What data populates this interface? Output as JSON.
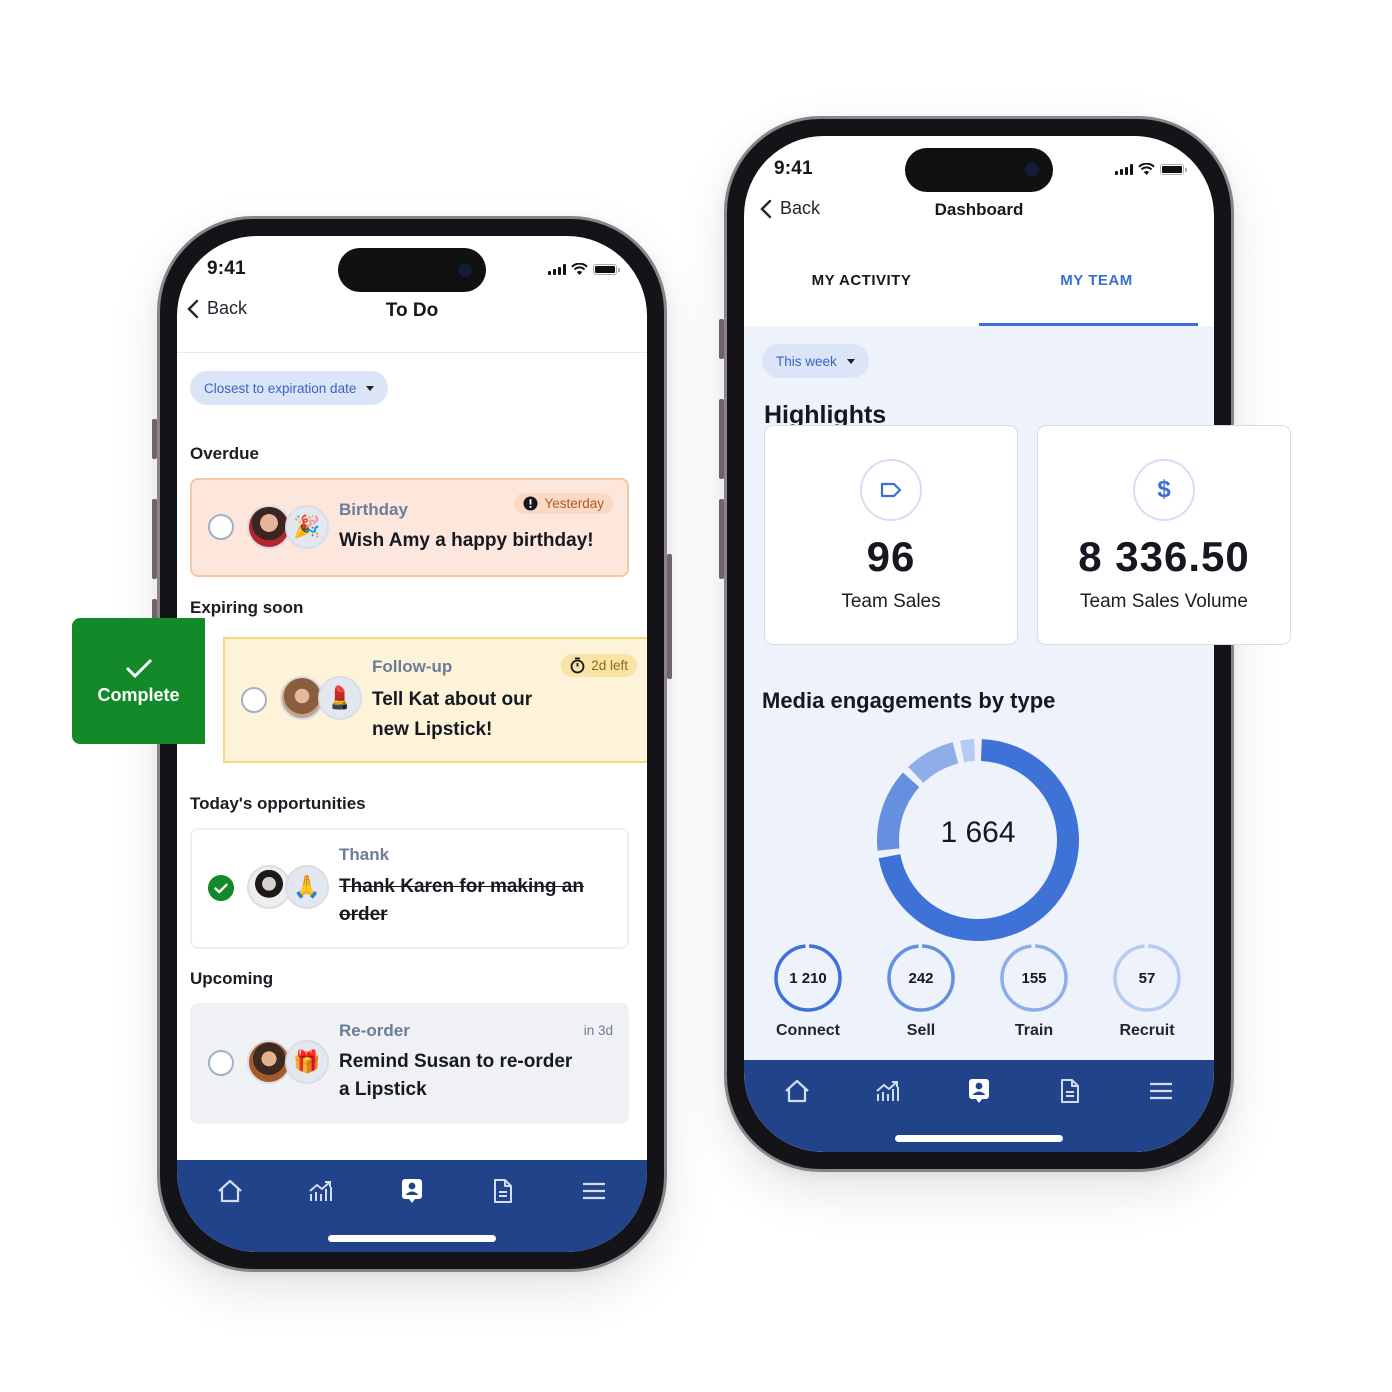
{
  "status_bar": {
    "time": "9:41"
  },
  "todo": {
    "back_label": "Back",
    "title": "To Do",
    "sort_filter": "Closest to expiration date",
    "sections": [
      {
        "heading": "Overdue",
        "task": {
          "type": "Birthday",
          "message": "Wish Amy a happy birthday!",
          "due": "Yesterday",
          "due_icon": "alert-icon",
          "emoji": "🎉",
          "completed": false
        }
      },
      {
        "heading": "Expiring soon",
        "task": {
          "type": "Follow-up",
          "message_line1": "Tell Kat about our",
          "message_line2": "new Lipstick!",
          "due": "2d left",
          "due_icon": "stopwatch-icon",
          "emoji": "💄",
          "completed": false
        }
      },
      {
        "heading": "Today's opportunities",
        "task": {
          "type": "Thank",
          "message_line1": "Thank Karen for making an",
          "message_line2": "order",
          "emoji": "🙏",
          "completed": true
        }
      },
      {
        "heading": "Upcoming",
        "task": {
          "type": "Re-order",
          "message_line1": "Remind Susan to re-order",
          "message_line2": "a Lipstick",
          "due": "in 3d",
          "emoji": "🎁",
          "completed": false
        }
      }
    ],
    "swipe_action": "Complete"
  },
  "dashboard": {
    "back_label": "Back",
    "title": "Dashboard",
    "tabs": [
      {
        "label": "MY ACTIVITY",
        "active": false
      },
      {
        "label": "MY TEAM",
        "active": true
      }
    ],
    "period_filter": "This week",
    "highlights_heading": "Highlights",
    "highlights": [
      {
        "icon": "tag-icon",
        "value": "96",
        "label": "Team Sales"
      },
      {
        "icon": "dollar-icon",
        "value": "8 336.50",
        "label": "Team Sales Volume"
      }
    ],
    "engagement_heading": "Media engagements by type",
    "total_display": "1 664"
  },
  "tab_bar": [
    {
      "name": "home",
      "icon": "home-icon",
      "active": false
    },
    {
      "name": "stats",
      "icon": "chart-icon",
      "active": false
    },
    {
      "name": "contacts",
      "icon": "contact-card-icon",
      "active": true
    },
    {
      "name": "documents",
      "icon": "document-icon",
      "active": false
    },
    {
      "name": "menu",
      "icon": "hamburger-icon",
      "active": false
    }
  ],
  "colors": {
    "accent": "#3b6fd1",
    "tab_bar": "#21438a",
    "success": "#138a29",
    "overdue_bg": "#fde6dc",
    "expiring_bg": "#fdf3d8"
  },
  "chart_data": {
    "type": "pie",
    "title": "Media engagements by type",
    "total": 1664,
    "categories": [
      "Connect",
      "Sell",
      "Train",
      "Recruit"
    ],
    "values": [
      1210,
      242,
      155,
      57
    ],
    "value_labels": [
      "1 210",
      "242",
      "155",
      "57"
    ],
    "colors": [
      "#3f72d6",
      "#6590df",
      "#8fade8",
      "#b6cbf1"
    ]
  }
}
